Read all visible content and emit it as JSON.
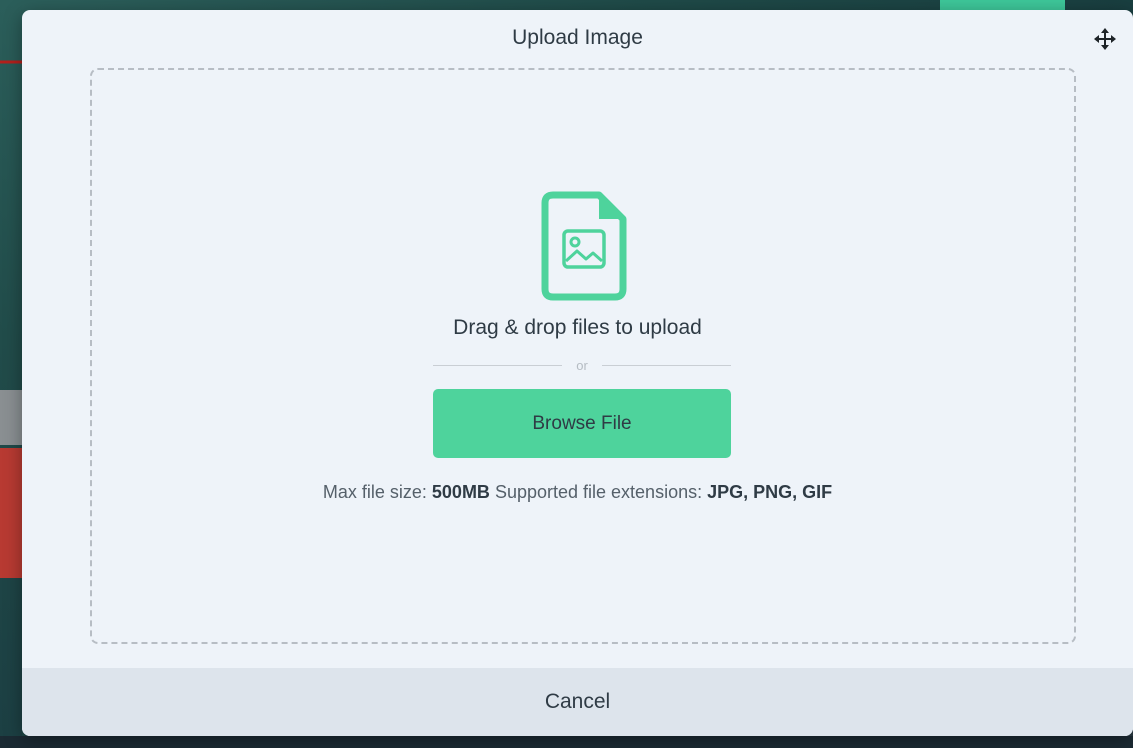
{
  "modal": {
    "title": "Upload Image",
    "move_icon": "move-arrows-icon"
  },
  "dropzone": {
    "icon": "image-file-icon",
    "drag_text": "Drag & drop files to upload",
    "divider_text": "or",
    "browse_label": "Browse File",
    "max_size_label": "Max file size:",
    "max_size_value": "500MB",
    "extensions_label": "Supported file extensions:",
    "extensions_value": "JPG, PNG, GIF"
  },
  "footer": {
    "cancel_label": "Cancel"
  },
  "colors": {
    "accent": "#4ed39c",
    "annotation": "#b3201c",
    "modal_bg": "#eef3f9",
    "footer_bg": "#dde4ec"
  }
}
